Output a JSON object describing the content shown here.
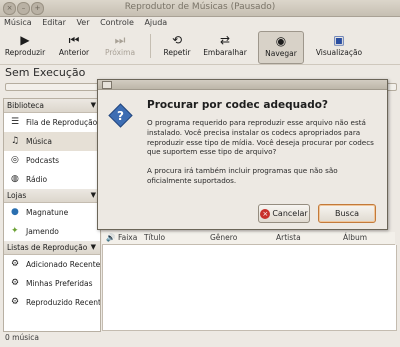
{
  "window": {
    "title": "Reprodutor de Músicas (Pausado)"
  },
  "menu": [
    "Música",
    "Editar",
    "Ver",
    "Controle",
    "Ajuda"
  ],
  "toolbar": {
    "play": "Reproduzir",
    "prev": "Anterior",
    "next": "Próxima",
    "repeat": "Repetir",
    "shuffle": "Embaralhar",
    "browse": "Navegar",
    "visual": "Visualização"
  },
  "now_playing": "Sem Execução",
  "sidebar": {
    "library_header": "Biblioteca",
    "library_items": [
      "Fila de Reprodução",
      "Música",
      "Podcasts",
      "Rádio"
    ],
    "stores_header": "Lojas",
    "store_items": [
      "Magnatune",
      "Jamendo"
    ],
    "playlists_header": "Listas de Reprodução",
    "playlist_items": [
      "Adicionado Recentemente",
      "Minhas Preferidas",
      "Reproduzido Recentemente"
    ]
  },
  "columns": [
    "Faixa",
    "Título",
    "Gênero",
    "Artista",
    "Álbum"
  ],
  "status": "0 música",
  "dialog": {
    "heading": "Procurar por codec adequado?",
    "body1": "O programa requerido para reproduzir esse arquivo não está instalado. Você precisa instalar os codecs apropriados para reproduzir esse tipo de mídia. Você deseja procurar por codecs que suportem esse tipo de arquivo?",
    "body2": "A procura irá também incluir programas que não são oficialmente suportados.",
    "cancel": "Cancelar",
    "search": "Busca"
  }
}
